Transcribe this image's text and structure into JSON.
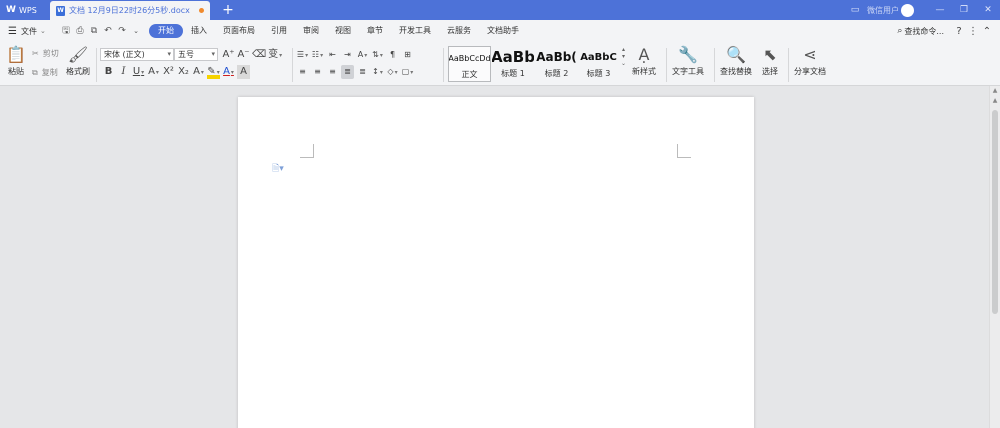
{
  "titlebar": {
    "app_tab": "WPS",
    "doc_tab": "文档 12月9日22时26分5秒.docx",
    "add_tab": "+",
    "user_label": "微信用户",
    "icons": [
      "window-icon",
      "avatar",
      "minimize-icon",
      "restore-icon",
      "close-icon"
    ]
  },
  "menubar": {
    "file": "文件",
    "tabs": [
      {
        "label": "开始",
        "active": true
      },
      {
        "label": "插入"
      },
      {
        "label": "页面布局"
      },
      {
        "label": "引用"
      },
      {
        "label": "审阅"
      },
      {
        "label": "视图"
      },
      {
        "label": "章节"
      },
      {
        "label": "开发工具"
      },
      {
        "label": "云服务"
      },
      {
        "label": "文档助手"
      }
    ],
    "search": "查找命令..."
  },
  "ribbon": {
    "paste": "粘贴",
    "cut": "剪切",
    "copy": "复制",
    "format_painter": "格式刷",
    "font_name": "宋体 (正文)",
    "font_size": "五号",
    "styles": [
      {
        "preview": "AaBbCcDd",
        "name": "正文"
      },
      {
        "preview": "AaBb",
        "name": "标题 1"
      },
      {
        "preview": "AaBb(",
        "name": "标题 2"
      },
      {
        "preview": "AaBbC",
        "name": "标题 3"
      }
    ],
    "new_style": "新样式",
    "text_tools": "文字工具",
    "find_replace": "查找替换",
    "select": "选择",
    "share_doc": "分享文档"
  },
  "colors": {
    "accent": "#4d72d8",
    "tab_dot": "#f08a2d",
    "workspace": "#e5e6e8",
    "toolbar": "#f3f4f6"
  }
}
